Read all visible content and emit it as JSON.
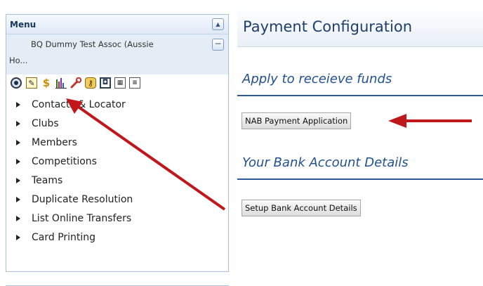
{
  "menu": {
    "title": "Menu",
    "association_line1": "BQ Dummy Test Assoc (Aussie",
    "association_line2": "Ho...",
    "toolbar_icons": [
      "eye-icon",
      "edit-icon",
      "dollar-icon",
      "chart-icon",
      "wrench-icon",
      "key-icon",
      "search-doc-icon",
      "calculator-icon",
      "list-icon"
    ],
    "items": [
      {
        "label": "Contacts & Locator"
      },
      {
        "label": "Clubs"
      },
      {
        "label": "Members"
      },
      {
        "label": "Competitions"
      },
      {
        "label": "Teams"
      },
      {
        "label": "Duplicate Resolution"
      },
      {
        "label": "List Online Transfers"
      },
      {
        "label": "Card Printing"
      }
    ]
  },
  "page": {
    "title": "Payment Configuration",
    "sections": [
      {
        "heading": "Apply to receieve funds",
        "button": "NAB Payment Application"
      },
      {
        "heading": "Your Bank Account Details",
        "button": "Setup Bank Account Details"
      }
    ]
  },
  "colors": {
    "arrow": "#c0171b",
    "heading": "#23508e",
    "panel_border": "#a9c1df"
  }
}
